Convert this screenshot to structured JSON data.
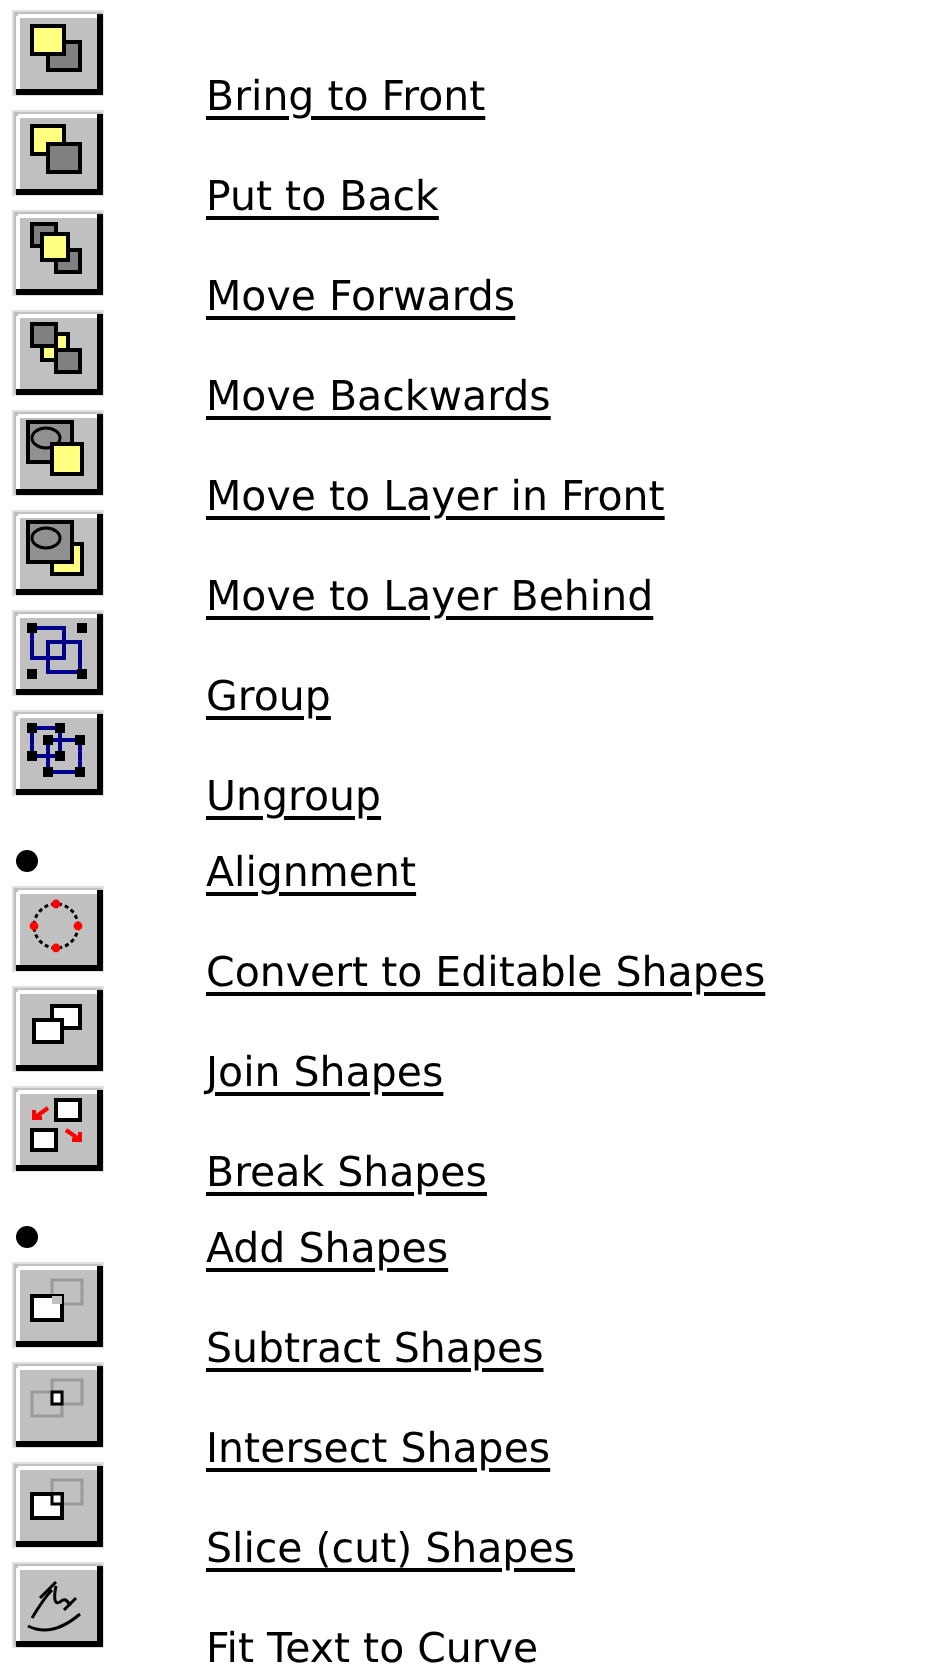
{
  "items": [
    {
      "kind": "icon",
      "label": "Bring to Front"
    },
    {
      "kind": "icon",
      "label": "Put to Back"
    },
    {
      "kind": "icon",
      "label": "Move Forwards"
    },
    {
      "kind": "icon",
      "label": "Move Backwards"
    },
    {
      "kind": "icon",
      "label": "Move to Layer in Front"
    },
    {
      "kind": "icon",
      "label": "Move to Layer Behind"
    },
    {
      "kind": "icon",
      "label": "Group"
    },
    {
      "kind": "icon",
      "label": "Ungroup"
    },
    {
      "kind": "bullet",
      "label": "Alignment"
    },
    {
      "kind": "icon",
      "label": "Convert to Editable Shapes"
    },
    {
      "kind": "icon",
      "label": "Join Shapes"
    },
    {
      "kind": "icon",
      "label": "Break Shapes"
    },
    {
      "kind": "bullet",
      "label": "Add Shapes"
    },
    {
      "kind": "icon",
      "label": "Subtract Shapes"
    },
    {
      "kind": "icon",
      "label": "Intersect Shapes"
    },
    {
      "kind": "icon",
      "label": "Slice (cut) Shapes"
    },
    {
      "kind": "icon",
      "label": "Fit Text to Curve"
    }
  ]
}
